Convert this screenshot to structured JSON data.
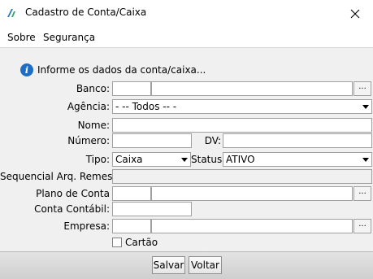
{
  "window": {
    "title": "Cadastro de Conta/Caixa"
  },
  "menu": {
    "sobre": "Sobre",
    "seguranca": "Segurança"
  },
  "info": {
    "message": "Informe os dados da conta/caixa..."
  },
  "form": {
    "banco": {
      "label": "Banco:",
      "code": "",
      "name": "",
      "button": "..."
    },
    "agencia": {
      "label": "Agência:",
      "selected": "- -- Todos -- -"
    },
    "nome": {
      "label": "Nome:",
      "value": ""
    },
    "numero": {
      "label": "Número:",
      "value": ""
    },
    "dv": {
      "label": "DV:",
      "value": ""
    },
    "tipo": {
      "label": "Tipo:",
      "selected": "Caixa"
    },
    "status": {
      "label": "Status:",
      "selected": "ATIVO"
    },
    "sequencial": {
      "label": "Sequencial Arq. Remessa:",
      "value": ""
    },
    "plano_conta": {
      "label": "Plano de Conta",
      "code": "",
      "name": "",
      "button": "..."
    },
    "conta_contabil": {
      "label": "Conta Contábil:",
      "value": ""
    },
    "empresa": {
      "label": "Empresa:",
      "code": "",
      "name": "",
      "button": "..."
    },
    "cartao": {
      "label": "Cartão",
      "checked": false
    }
  },
  "buttons": {
    "salvar": "Salvar",
    "voltar": "Voltar"
  }
}
